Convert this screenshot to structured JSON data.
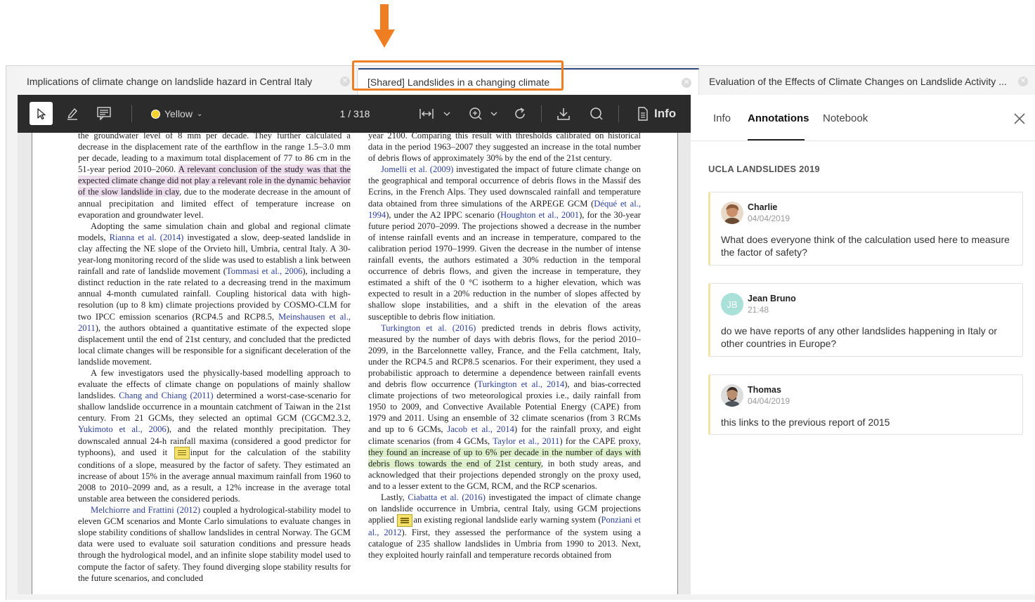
{
  "tabs": [
    {
      "title": "Implications of climate change on landslide hazard in Central Italy"
    },
    {
      "title": "[Shared] Landslides in a changing climate"
    },
    {
      "title": "Evaluation of the Effects of Climate Changes on Landslide Activity ..."
    }
  ],
  "toolbar": {
    "color_label": "Yellow",
    "page_indicator": "1 / 318",
    "info_label": "Info",
    "icons": [
      "select-arrow-icon",
      "pen-icon",
      "comment-icon",
      "fit-width-icon",
      "zoom-in-icon",
      "rotate-icon",
      "download-icon",
      "search-icon",
      "info-icon"
    ]
  },
  "colors": {
    "accent": "#ef7d22",
    "active_tab": "#2f4a7e",
    "highlight_pink": "#ecdcec",
    "highlight_green": "#dff0cc",
    "toolbar": "#2b2b2b"
  },
  "document": {
    "col1": [
      {
        "segs": [
          {
            "t": "the groundwater level of 8 mm per decade. They further calculated a decrease in the displacement rate of the earthflow in the range 1.5–3.0 mm per decade, leading to a maximum total displacement of 77 to 86 cm in the 51-year period 2010–2060. "
          },
          {
            "t": "A relevant conclusion of the study was that the expected climate change did not play a relevant role in the dynamic behavior of the slow landslide in clay",
            "c": "hl-pink"
          },
          {
            "t": ", due to the moderate decrease in the amount of annual precipitation and limited effect of temperature increase on evaporation and groundwater level."
          }
        ]
      },
      {
        "ind": true,
        "segs": [
          {
            "t": "Adopting the same simulation chain and global and regional climate models, "
          },
          {
            "t": "Rianna et al. (2014)",
            "c": "lk"
          },
          {
            "t": " investigated a slow, deep-seated landslide in clay affecting the NE slope of the Orvieto hill, Umbria, central Italy. A 30-year-long monitoring record of the slide was used to establish a link between rainfall and rate of landslide movement ("
          },
          {
            "t": "Tommasi et al., 2006",
            "c": "lk"
          },
          {
            "t": "), including a distinct reduction in the rate related to a decreasing trend in the maximum annual 4-month cumulated rainfall. Coupling historical data with high-resolution (up to 8 km) climate projections provided by COSMO-CLM for two IPCC emission scenarios (RCP4.5 and RCP8.5, "
          },
          {
            "t": "Meinshausen et al., 2011",
            "c": "lk"
          },
          {
            "t": "), the authors obtained a quantitative estimate of the expected slope displacement until the end of 21st century, and concluded that the predicted local climate changes will be responsible for a significant deceleration of the landslide movement."
          }
        ]
      },
      {
        "ind": true,
        "segs": [
          {
            "t": "A few investigators used the physically-based modelling approach to evaluate the effects of climate change on populations of mainly shallow landslides. "
          },
          {
            "t": "Chang and Chiang (2011)",
            "c": "lk"
          },
          {
            "t": " determined a worst-case-scenario for shallow landslide occurrence in a mountain catchment of Taiwan in the 21st century. From 21 GCMs, they selected an optimal GCM (CGCM2.3.2, "
          },
          {
            "t": "Yukimoto et al., 2006",
            "c": "lk"
          },
          {
            "t": "), and the related monthly precipitation. They downscaled annual 24-h rainfall maxima (considered a good predictor for typhoons), and used it "
          },
          {
            "t": "",
            "c": "note"
          },
          {
            "t": "input for the calculation of the stability conditions of a slope, measured by the factor of safety. They estimated an increase of about 15% in the average annual maximum rainfall from 1960 to 2008 to 2010–2099 and, as a result, a 12% increase in the average total unstable area between the considered periods."
          }
        ]
      },
      {
        "ind": true,
        "segs": [
          {
            "t": "Melchiorre and Frattini (2012)",
            "c": "lk"
          },
          {
            "t": " coupled a hydrological-stability model to eleven GCM scenarios and Monte Carlo simulations to evaluate changes in slope stability conditions of shallow landslides in central Norway. The GCM data were used to evaluate soil saturation conditions and pressure heads through the hydrological model, and an infinite slope stability model used to compute the factor of safety. They found diverging slope stability results for the future scenarios, and concluded"
          }
        ]
      }
    ],
    "col2": [
      {
        "segs": [
          {
            "t": "year 2100. Comparing this result with thresholds calibrated on historical data in the period 1963–2007 they suggested an increase in the total number of debris flows of approximately 30% by the end of the 21st century."
          }
        ]
      },
      {
        "ind": true,
        "segs": [
          {
            "t": "Jomelli et al. (2009)",
            "c": "lk"
          },
          {
            "t": " investigated the impact of future climate change on the geographical and temporal occurrence of debris flows in the Massif des Ecrins, in the French Alps. They used downscaled rainfall and temperature data obtained from three simulations of the ARPEGE GCM ("
          },
          {
            "t": "Déqué et al., 1994",
            "c": "lk"
          },
          {
            "t": "), under the A2 IPPC scenario ("
          },
          {
            "t": "Houghton et al., 2001",
            "c": "lk"
          },
          {
            "t": "), for the 30-year future period 2070–2099. The projections showed a decrease in the number of intense rainfall events and an increase in temperature, compared to the calibration period 1970–1999. Given the decrease in the number of intense rainfall events, the authors estimated a 30% reduction in the temporal occurrence of debris flows, and given the increase in temperature, they estimated a shift of the 0 °C isotherm to a higher elevation, which was expected to result in a 20% reduction in the number of slopes affected by shallow slope instabilities, and a shift in the elevation of the areas susceptible to debris flow initiation."
          }
        ]
      },
      {
        "ind": true,
        "segs": [
          {
            "t": "Turkington et al. (2016)",
            "c": "lk"
          },
          {
            "t": " predicted trends in debris flows activity, measured by the number of days with debris flows, for the period 2010–2099, in the Barcelonnette valley, France, and the Fella catchment, Italy, under the RCP4.5 and RCP8.5 scenarios. For their experiment, they used a probabilistic approach to determine a dependence between rainfall events and debris flow occurrence ("
          },
          {
            "t": "Turkington et al., 2014",
            "c": "lk"
          },
          {
            "t": "), and bias-corrected climate projections of two meteorological proxies i.e., daily rainfall from 1950 to 2009, and Convective Available Potential Energy (CAPE) from 1979 and 2011. Using an ensemble of 32 climate scenarios (from 3 RCMs and up to 6 GCMs, "
          },
          {
            "t": "Jacob et al., 2014",
            "c": "lk"
          },
          {
            "t": ") for the rainfall proxy, and eight climate scenarios (from 4 GCMs, "
          },
          {
            "t": "Taylor et al., 2011",
            "c": "lk"
          },
          {
            "t": ") for the CAPE proxy, "
          },
          {
            "t": "they found an increase of up to 6% per decade in the number of days with debris flows towards the end of 21st century",
            "c": "hl-green"
          },
          {
            "t": ", in both study areas, and acknowledged that their projections depended strongly on the proxy used, and to a lesser extent to the GCM, RCM, and the RCP scenarios."
          }
        ]
      },
      {
        "ind": true,
        "segs": [
          {
            "t": "Lastly, "
          },
          {
            "t": "Ciabatta et al. (2016)",
            "c": "lk"
          },
          {
            "t": " investigated the impact of climate change on landslide occurrence in Umbria, central Italy, using GCM projections applied "
          },
          {
            "t": "",
            "c": "note"
          },
          {
            "t": "an existing regional landslide early warning system ("
          },
          {
            "t": "Ponziani et al., 2012",
            "c": "lk"
          },
          {
            "t": "). First, they assessed the performance of the system using a catalogue of 235 shallow landslides in Umbria from 1990 to 2013. Next, they exploited hourly rainfall and temperature records obtained from"
          }
        ]
      }
    ]
  },
  "sidebar": {
    "tabs": [
      "Info",
      "Annotations",
      "Notebook"
    ],
    "group_title": "UCLA LANDSLIDES 2019",
    "annotations": [
      {
        "name": "Charlie",
        "date": "04/04/2019",
        "text": "What does everyone think of the calculation used here to measure the factor of safety?",
        "initials": ""
      },
      {
        "name": "Jean Bruno",
        "date": "21:48",
        "text": "do we have reports of any other landslides happening in Italy or other countries in Europe?",
        "initials": "JB"
      },
      {
        "name": "Thomas",
        "date": "04/04/2019",
        "text": "this links to the previous report of 2015",
        "initials": ""
      }
    ]
  }
}
